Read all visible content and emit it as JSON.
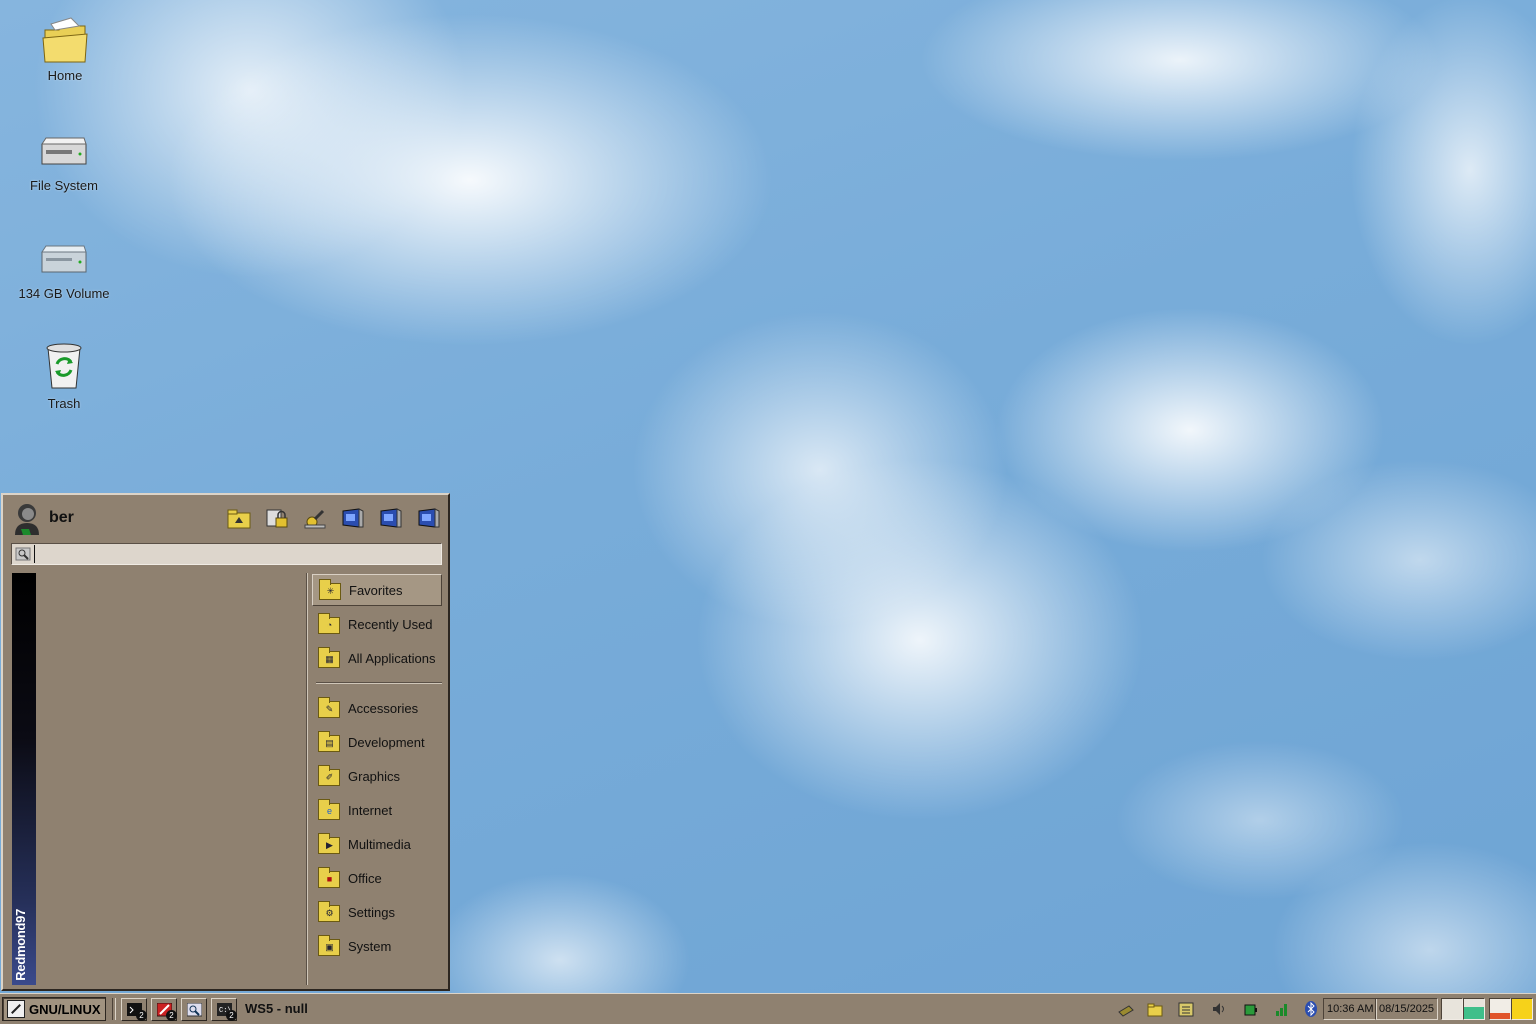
{
  "desktop": {
    "icons": [
      {
        "label": "Home",
        "icon": "home-folder-icon"
      },
      {
        "label": "File System",
        "icon": "drive-icon"
      },
      {
        "label": "134 GB Volume",
        "icon": "drive-icon"
      },
      {
        "label": "Trash",
        "icon": "trash-icon"
      }
    ]
  },
  "start_menu": {
    "username": "ber",
    "brand": "Redmond97",
    "search": {
      "value": "",
      "placeholder": ""
    },
    "header_buttons": [
      "home-folder-icon",
      "lock-icon",
      "settings-icon",
      "window-icon",
      "window-icon",
      "window-icon"
    ],
    "categories_top": [
      {
        "label": "Favorites",
        "active": true
      },
      {
        "label": "Recently Used"
      },
      {
        "label": "All Applications"
      }
    ],
    "categories": [
      {
        "label": "Accessories"
      },
      {
        "label": "Development"
      },
      {
        "label": "Graphics"
      },
      {
        "label": "Internet"
      },
      {
        "label": "Multimedia"
      },
      {
        "label": "Office"
      },
      {
        "label": "Settings"
      },
      {
        "label": "System"
      }
    ]
  },
  "taskbar": {
    "start_label": "GNU/LINUX",
    "launchers": [
      {
        "icon": "terminal-icon",
        "badge": "2"
      },
      {
        "icon": "tools-icon",
        "badge": "2"
      },
      {
        "icon": "search-icon",
        "badge": ""
      },
      {
        "icon": "terminal-window-icon",
        "badge": "2"
      }
    ],
    "window_title": "WS5 - null",
    "tray_icons": [
      "notes-icon",
      "folder-icon",
      "network-icon",
      "volume-icon",
      "battery-icon",
      "signal-icon",
      "bluetooth-icon"
    ],
    "time": "10:36 AM",
    "date": "08/15/2025",
    "accent": "#8f8170"
  }
}
